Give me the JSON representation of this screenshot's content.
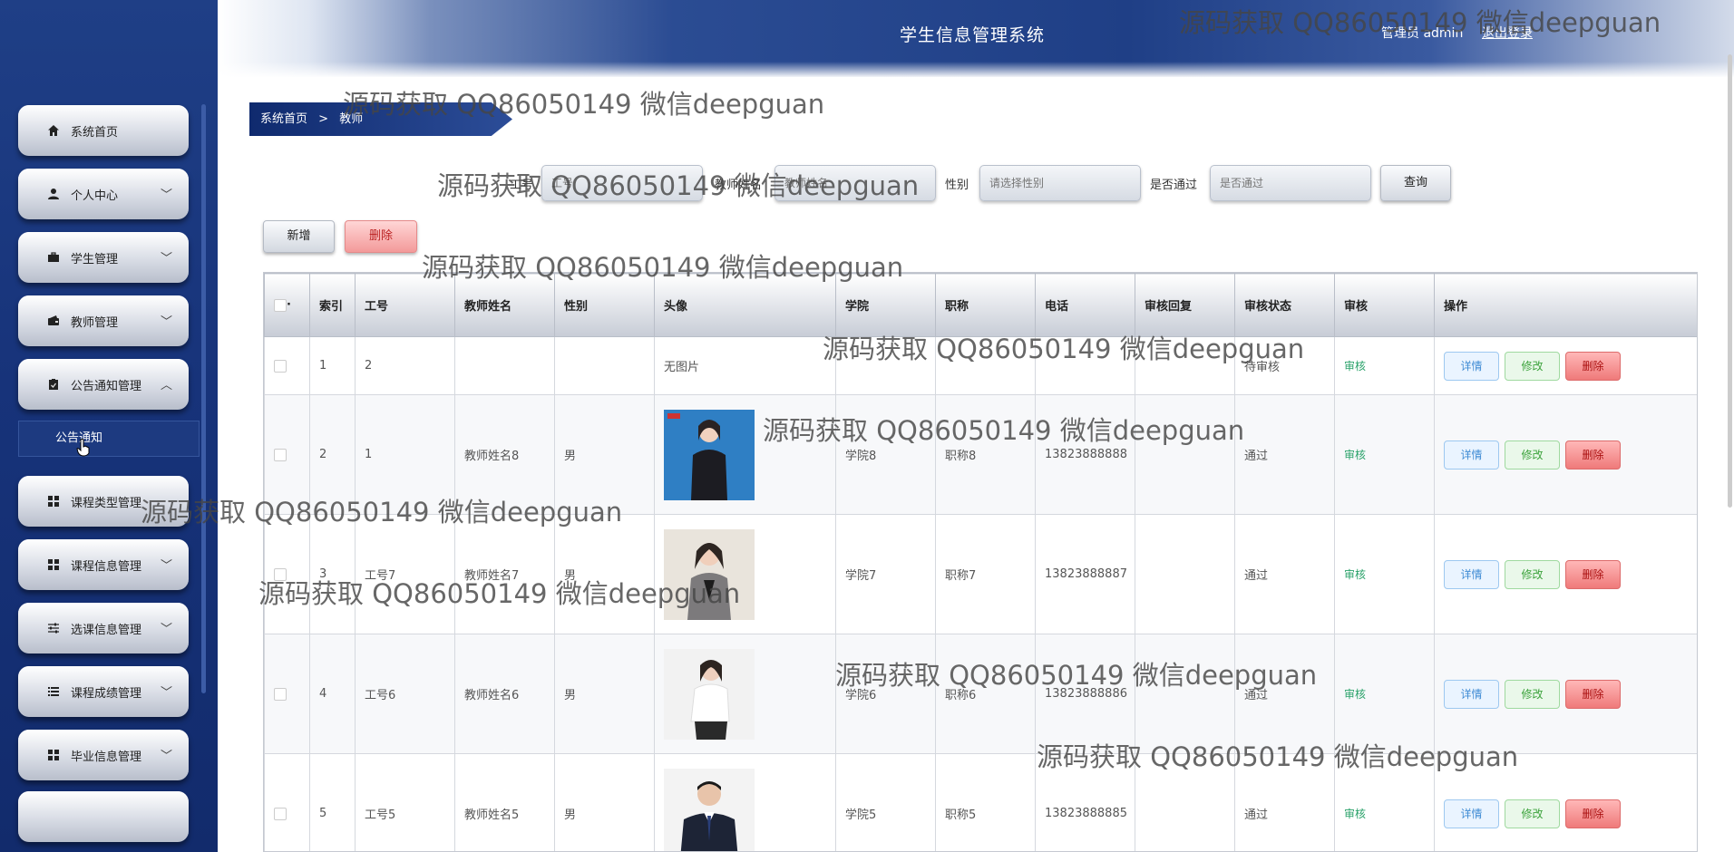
{
  "sidebar": {
    "items": [
      {
        "label": "系统首页",
        "icon": "home-icon",
        "has_chevron": false,
        "chevron": ""
      },
      {
        "label": "个人中心",
        "icon": "user-icon",
        "has_chevron": true,
        "chevron": "﹀"
      },
      {
        "label": "学生管理",
        "icon": "briefcase-icon",
        "has_chevron": true,
        "chevron": "﹀"
      },
      {
        "label": "教师管理",
        "icon": "wallet-icon",
        "has_chevron": true,
        "chevron": "﹀"
      },
      {
        "label": "公告通知管理",
        "icon": "clipboard-icon",
        "has_chevron": true,
        "chevron": "︿"
      },
      {
        "label": "课程类型管理",
        "icon": "grid-icon",
        "has_chevron": false,
        "chevron": ""
      },
      {
        "label": "课程信息管理",
        "icon": "grid-icon",
        "has_chevron": true,
        "chevron": "﹀"
      },
      {
        "label": "选课信息管理",
        "icon": "sliders-icon",
        "has_chevron": true,
        "chevron": "﹀"
      },
      {
        "label": "课程成绩管理",
        "icon": "list-icon",
        "has_chevron": true,
        "chevron": "﹀"
      },
      {
        "label": "毕业信息管理",
        "icon": "grid-icon",
        "has_chevron": true,
        "chevron": "﹀"
      }
    ],
    "sub_item": "公告通知"
  },
  "header": {
    "title": "学生信息管理系统",
    "user": "管理员 admin",
    "logout": "退出登录"
  },
  "breadcrumb": {
    "home": "系统首页",
    "separator": ">",
    "current": "教师"
  },
  "search": {
    "fields": [
      {
        "label": "工号",
        "placeholder": "工号"
      },
      {
        "label": "教师姓名",
        "placeholder": "教师姓名"
      },
      {
        "label": "性别",
        "placeholder": "请选择性别"
      },
      {
        "label": "是否通过",
        "placeholder": "是否通过"
      }
    ],
    "query_button": "查询"
  },
  "actions": {
    "add": "新增",
    "delete": "删除"
  },
  "table": {
    "columns": [
      "·",
      "索引",
      "工号",
      "教师姓名",
      "性别",
      "头像",
      "学院",
      "职称",
      "电话",
      "审核回复",
      "审核状态",
      "审核",
      "操作"
    ],
    "rows": [
      {
        "index": "1",
        "id": "2",
        "name": "",
        "gender": "",
        "avatar": "无图片",
        "college": "",
        "title": "",
        "phone": "",
        "reply": "",
        "status": "待审核",
        "audit": "审核"
      },
      {
        "index": "2",
        "id": "1",
        "name": "教师姓名8",
        "gender": "男",
        "avatar": "photo-woman-black-suit",
        "college": "学院8",
        "title": "职称8",
        "phone": "13823888888",
        "reply": "",
        "status": "通过",
        "audit": "审核"
      },
      {
        "index": "3",
        "id": "工号7",
        "name": "教师姓名7",
        "gender": "男",
        "avatar": "photo-woman-grey-blazer",
        "college": "学院7",
        "title": "职称7",
        "phone": "13823888887",
        "reply": "",
        "status": "通过",
        "audit": "审核"
      },
      {
        "index": "4",
        "id": "工号6",
        "name": "教师姓名6",
        "gender": "男",
        "avatar": "photo-woman-white-blouse",
        "college": "学院6",
        "title": "职称6",
        "phone": "13823888886",
        "reply": "",
        "status": "通过",
        "audit": "审核"
      },
      {
        "index": "5",
        "id": "工号5",
        "name": "教师姓名5",
        "gender": "男",
        "avatar": "photo-man-dark-suit",
        "college": "学院5",
        "title": "职称5",
        "phone": "13823888885",
        "reply": "",
        "status": "通过",
        "audit": "审核"
      }
    ],
    "row_buttons": {
      "detail": "详情",
      "edit": "修改",
      "delete": "删除"
    }
  },
  "watermark": "源码获取 QQ86050149 微信deepguan",
  "colors": {
    "sidebar_bg": "#17337a",
    "accent_green": "#2aa26a",
    "delete_red": "#ef7a7a"
  }
}
